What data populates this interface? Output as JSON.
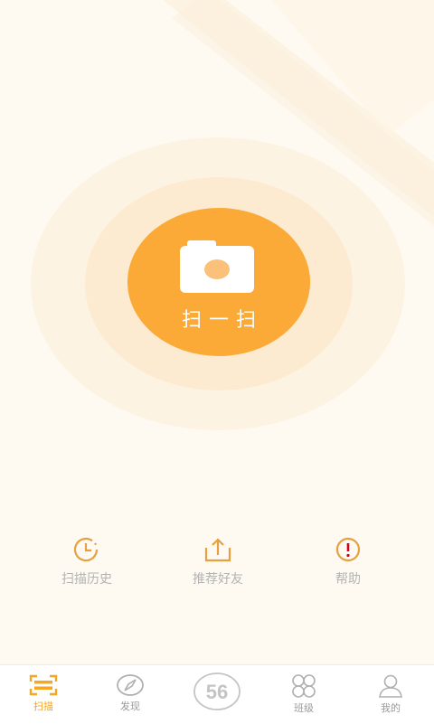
{
  "main": {
    "scan_label": "扫一扫"
  },
  "actions": [
    {
      "label": "扫描历史",
      "icon": "history-clock-icon"
    },
    {
      "label": "推荐好友",
      "icon": "share-upload-icon"
    },
    {
      "label": "帮助",
      "icon": "help-exclamation-icon"
    }
  ],
  "tabbar": {
    "active": "扫描",
    "tabs": [
      {
        "label": "扫描",
        "icon": "scan-icon"
      },
      {
        "label": "发现",
        "icon": "compass-icon"
      },
      {
        "label": "",
        "icon": "56-logo-icon",
        "logo_text": "56"
      },
      {
        "label": "班级",
        "icon": "four-petal-grid-icon"
      },
      {
        "label": "我的",
        "icon": "user-profile-icon"
      }
    ]
  },
  "colors": {
    "accent": "#fbaa37",
    "active_tab": "#f5a623",
    "icon_orange": "#e6a040",
    "label_gray": "#b3b3b3",
    "background": "#fefaf2"
  }
}
